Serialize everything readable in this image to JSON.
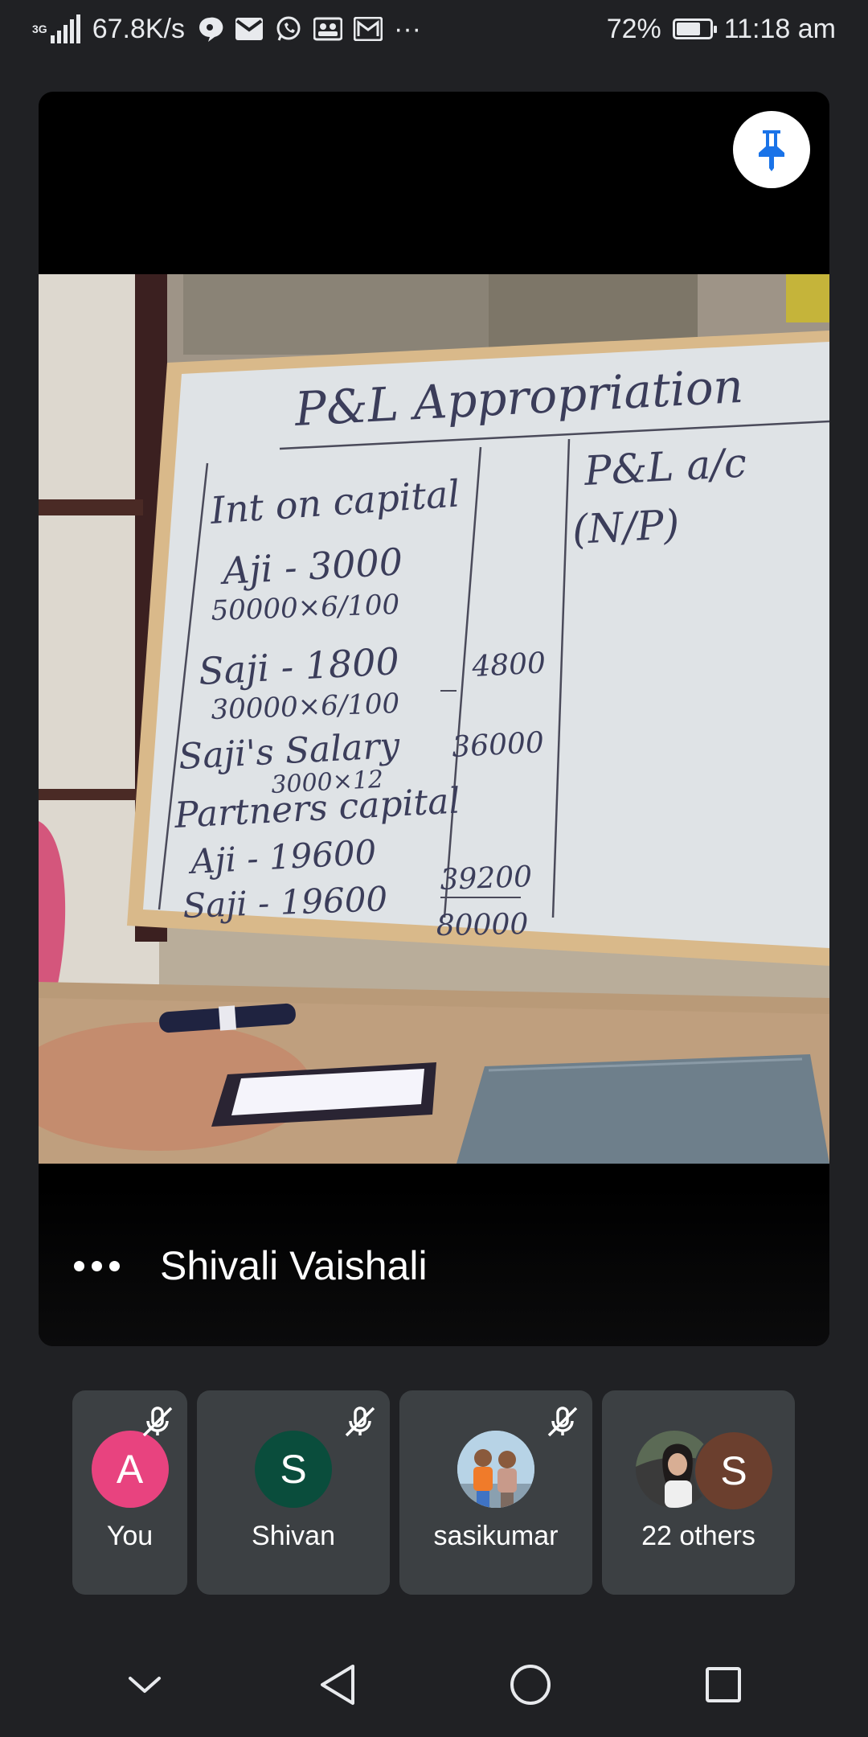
{
  "status_bar": {
    "network_type": "3G",
    "net_speed": "67.8K/s",
    "battery_percent": "72%",
    "battery_level": 0.72,
    "time": "11:18 am",
    "more": "···",
    "notification_icons": [
      "chat-bubble-icon",
      "gmail-icon",
      "whatsapp-icon",
      "contacts-icon",
      "gmail-icon"
    ]
  },
  "main_tile": {
    "speaker_name": "Shivali Vaishali",
    "whiteboard": {
      "title": "P&L Appropriation",
      "right_heading_1": "P&L a/c",
      "right_heading_2": "(N/P)",
      "line_1": "Int on capital",
      "line_2": "Aji - 3000",
      "line_3": "50000×6/100",
      "line_4": "Saji - 1800",
      "line_5": "30000×6/100",
      "line_6": "Saji's Salary",
      "line_7": "3000×12",
      "line_8": "Partners capital",
      "line_9": "Aji - 19600",
      "line_10": "Saji - 19600",
      "amt_1": "4800",
      "amt_2": "36000",
      "amt_3": "39200",
      "amt_total": "80000"
    }
  },
  "participants": [
    {
      "name": "You",
      "initial": "A",
      "color": "#e8437f",
      "muted": true
    },
    {
      "name": "Shivan",
      "initial": "S",
      "color": "#0a4d3c",
      "muted": true
    },
    {
      "name": "sasikumar",
      "initial": "",
      "color": "#a8c8e0",
      "muted": true
    },
    {
      "name": "22 others",
      "initial": "S",
      "color": "#6b3f2e",
      "muted": false
    }
  ],
  "colors": {
    "background": "#202124",
    "tile": "#3c4043",
    "pin_blue": "#1a73e8"
  }
}
